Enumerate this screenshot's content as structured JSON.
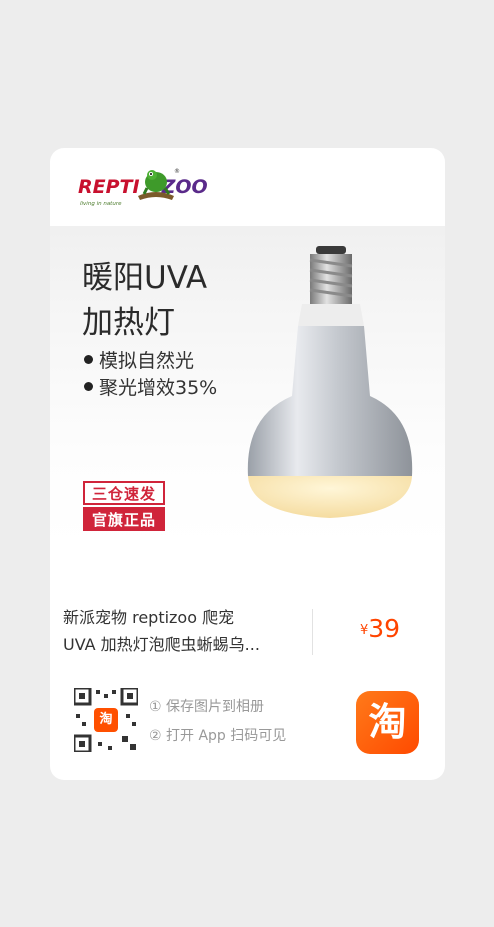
{
  "logo": {
    "brand_left": "REPTI",
    "brand_right": "ZOO",
    "tagline": "living in nature",
    "registered": "®"
  },
  "banner": {
    "title_line1": "暖阳UVA",
    "title_line2": "加热灯",
    "features": [
      "模拟自然光",
      "聚光增效35%"
    ],
    "badge_top": "三仓速发",
    "badge_bottom": "官旗正品"
  },
  "product": {
    "name_line1": "新派宠物 reptizoo 爬宠",
    "name_line2": "UVA 加热灯泡爬虫蜥蜴乌...",
    "currency": "¥",
    "price": "39"
  },
  "share": {
    "qr_center": "淘",
    "step1": "① 保存图片到相册",
    "step2": "② 打开 App 扫码可见",
    "app_icon": "淘"
  },
  "colors": {
    "accent": "#ff4400",
    "badge_red": "#d0243a",
    "taobao_orange": "#ff5000"
  }
}
